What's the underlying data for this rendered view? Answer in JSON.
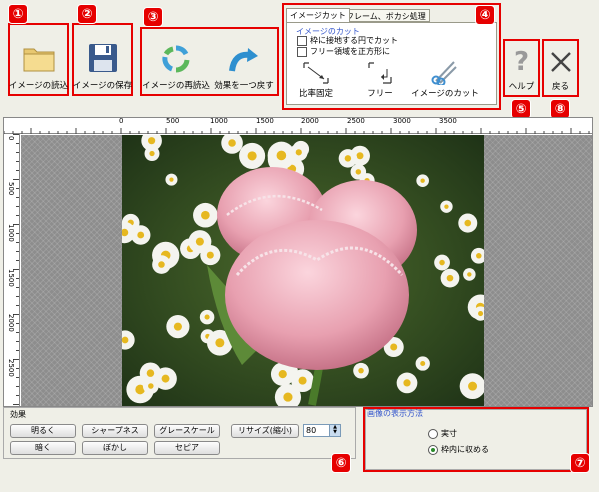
{
  "toolbar": {
    "open_label": "イメージの読込",
    "save_label": "イメージの保存",
    "reload_label": "イメージの再読込",
    "undo_label": "効果を一つ戻す",
    "help_label": "ヘルプ",
    "back_label": "戻る"
  },
  "markers": [
    "①",
    "②",
    "③",
    "④",
    "⑤",
    "⑥",
    "⑦",
    "⑧"
  ],
  "cut_panel": {
    "tabs": [
      "イメージカット",
      "フレーム、ボカシ処理"
    ],
    "group_title": "イメージのカット",
    "options": [
      "枠に接地する円でカット",
      "フリー領域を正方形に"
    ],
    "buttons": [
      "比率固定",
      "フリー",
      "イメージのカット"
    ]
  },
  "ruler": {
    "h_ticks": [
      "0",
      "500",
      "1000",
      "1500",
      "2000",
      "2500",
      "3000",
      "3500"
    ],
    "v_ticks": [
      "0",
      "500",
      "1000",
      "1500",
      "2000",
      "2500"
    ]
  },
  "effects": {
    "title": "効果",
    "row1": [
      "明るく",
      "シャープネス",
      "グレースケール",
      "リサイズ(縮小)"
    ],
    "row2": [
      "暗く",
      "ぼかし",
      "セピア"
    ],
    "resize_value": "80"
  },
  "display": {
    "title": "画像の表示方法",
    "options": [
      "実寸",
      "枠内に収める"
    ],
    "selected": "枠内に収める"
  },
  "colors": {
    "accent_red": "#e60000",
    "link_blue": "#3355cc"
  }
}
